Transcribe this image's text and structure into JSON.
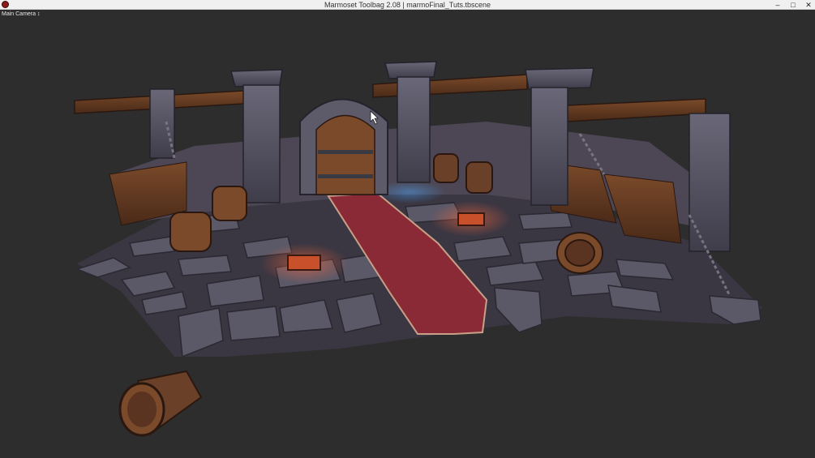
{
  "window": {
    "title": "Marmoset Toolbag 2.08  |  marmoFinal_Tuts.tbscene",
    "buttons": {
      "minimize": "–",
      "maximize": "□",
      "close": "✕"
    }
  },
  "viewport": {
    "camera_label": "Main Camera",
    "camera_arrow": "↕",
    "background": "#2d2d2d",
    "icons": [
      "app-icon",
      "mouse-cursor-icon"
    ]
  }
}
